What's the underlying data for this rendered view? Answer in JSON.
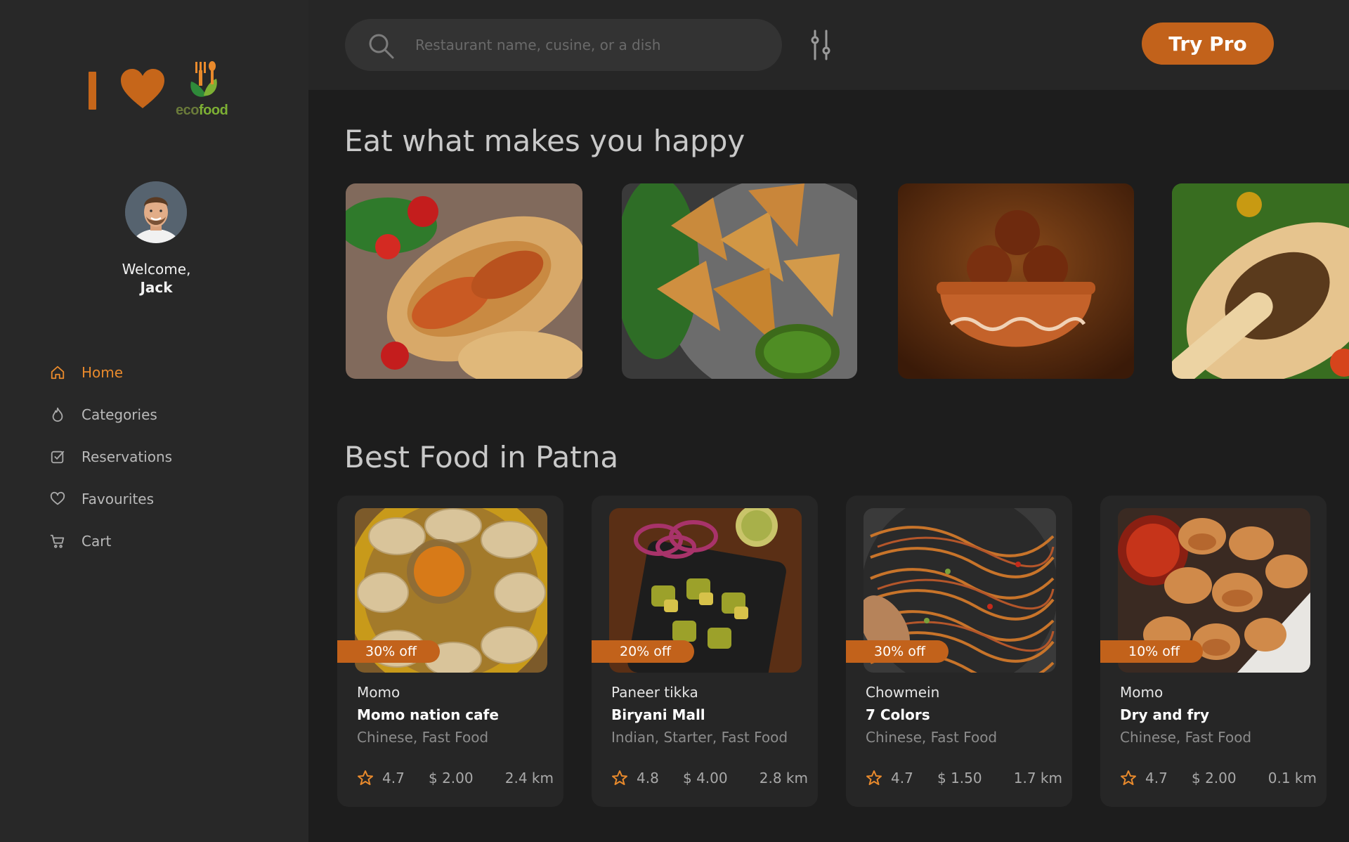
{
  "brand": {
    "logo_text_eco": "eco",
    "logo_text_food": "food",
    "accent": "#c2621b"
  },
  "user": {
    "greeting": "Welcome,",
    "name": "Jack"
  },
  "nav": [
    {
      "label": "Home",
      "icon": "home-icon",
      "active": true
    },
    {
      "label": "Categories",
      "icon": "flame-icon",
      "active": false
    },
    {
      "label": "Reservations",
      "icon": "checkbox-icon",
      "active": false
    },
    {
      "label": "Favourites",
      "icon": "heart-icon",
      "active": false
    },
    {
      "label": "Cart",
      "icon": "cart-icon",
      "active": false
    }
  ],
  "search": {
    "placeholder": "Restaurant name, cusine, or a dish"
  },
  "header": {
    "cta_label": "Try Pro"
  },
  "sections": {
    "happy_title": "Eat what makes you happy",
    "best_title": "Best Food in Patna"
  },
  "hero_items": [
    {
      "name": "paratha-wrap-image"
    },
    {
      "name": "samosa-image"
    },
    {
      "name": "gulab-jamun-image"
    },
    {
      "name": "dosa-image"
    }
  ],
  "restaurants": [
    {
      "discount": "30% off",
      "dish": "Momo",
      "restaurant": "Momo nation cafe",
      "cuisine": "Chinese, Fast Food",
      "rating": "4.7",
      "price": "$ 2.00",
      "distance": "2.4 km"
    },
    {
      "discount": "20% off",
      "dish": "Paneer tikka",
      "restaurant": "Biryani Mall",
      "cuisine": "Indian, Starter, Fast Food",
      "rating": "4.8",
      "price": "$ 4.00",
      "distance": "2.8 km"
    },
    {
      "discount": "30% off",
      "dish": "Chowmein",
      "restaurant": "7 Colors",
      "cuisine": "Chinese, Fast Food",
      "rating": "4.7",
      "price": "$ 1.50",
      "distance": "1.7 km"
    },
    {
      "discount": "10% off",
      "dish": "Momo",
      "restaurant": "Dry and fry",
      "cuisine": "Chinese, Fast Food",
      "rating": "4.7",
      "price": "$ 2.00",
      "distance": "0.1 km"
    }
  ]
}
